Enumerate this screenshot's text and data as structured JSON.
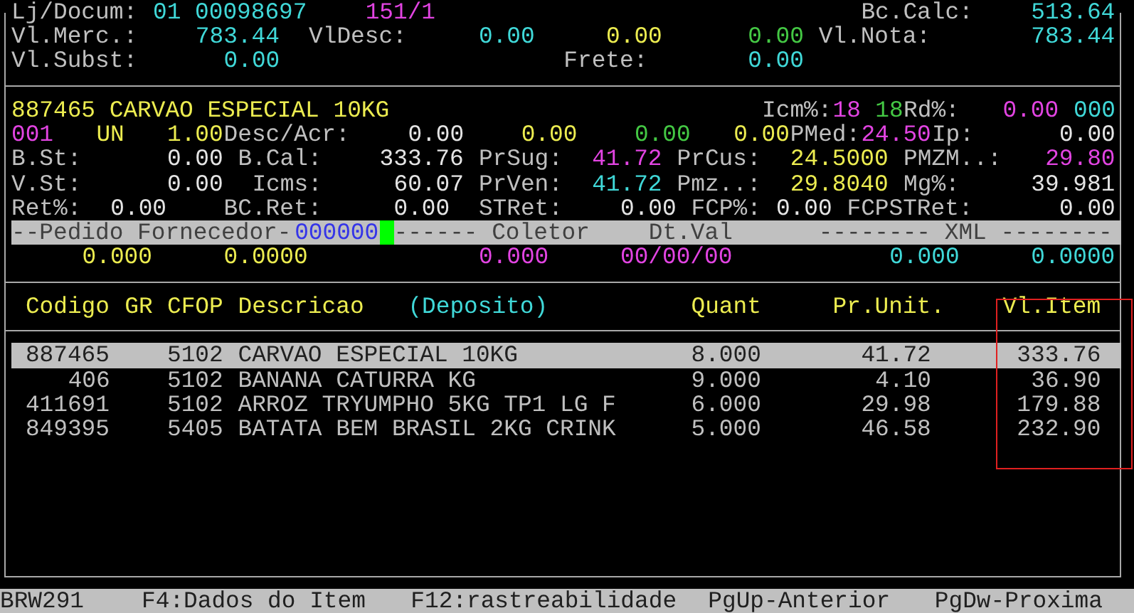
{
  "header_lines": [
    [
      "Lj/Docum:",
      "01 00098697",
      "151/1",
      "Bc.Calc:",
      "513.64"
    ],
    [
      "Vl.Merc.:",
      "783.44",
      "VlDesc:",
      "0.00",
      "0.00",
      "0.00",
      "Vl.Nota:",
      "783.44"
    ],
    [
      "Vl.Subst:",
      "0.00",
      "Frete:",
      "0.00"
    ]
  ],
  "item_lines": [
    [
      "887465 CARVAO ESPECIAL 10KG",
      "Icm%:",
      "18",
      "18",
      "Rd%:",
      "0.00",
      "000"
    ],
    [
      "001",
      "UN",
      "1.00",
      "Desc/Acr:",
      "0.00",
      "0.00",
      "0.00",
      "0.00",
      "PMed:",
      "24.50",
      "Ip:",
      "0.00"
    ],
    [
      "B.St:",
      "0.00",
      "B.Cal:",
      "333.76",
      "PrSug:",
      "41.72",
      "PrCus:",
      "24.5000",
      "PMZM..:",
      "29.80"
    ],
    [
      "V.St:",
      "0.00",
      "Icms:",
      "60.07",
      "PrVen:",
      "41.72",
      "Pmz..:",
      "29.8040",
      "Mg%:",
      "39.981"
    ],
    [
      "Ret%:",
      "0.00",
      "BC.Ret:",
      "0.00",
      "STRet:",
      "0.00",
      "FCP%:",
      "0.00",
      "FCPSTRet:",
      "0.00"
    ]
  ],
  "order_bar": [
    "--Pedido Fornecedor-",
    "000000",
    "------ Coletor",
    "Dt.Val",
    "-------- XML --------"
  ],
  "order_values": [
    "0.000",
    "0.0000",
    "0.000",
    "00/00/00",
    "0.000",
    "0.0000"
  ],
  "table": {
    "columns": [
      "Codigo",
      "GR",
      "CFOP",
      "Descricao",
      "(Deposito)",
      "Quant",
      "Pr.Unit.",
      "Vl.Item"
    ],
    "rows": [
      {
        "code": "887465",
        "cfop": "5102",
        "description": "CARVAO ESPECIAL 10KG",
        "quantity": "8.000",
        "unit_price": "41.72",
        "item_value": "333.76",
        "selected": true
      },
      {
        "code": "406",
        "cfop": "5102",
        "description": "BANANA CATURRA KG",
        "quantity": "9.000",
        "unit_price": "4.10",
        "item_value": "36.90",
        "selected": false
      },
      {
        "code": "411691",
        "cfop": "5102",
        "description": "ARROZ TRYUMPHO 5KG TP1 LG F",
        "quantity": "6.000",
        "unit_price": "29.98",
        "item_value": "179.88",
        "selected": false
      },
      {
        "code": "849395",
        "cfop": "5405",
        "description": "BATATA BEM BRASIL 2KG CRINK",
        "quantity": "5.000",
        "unit_price": "46.58",
        "item_value": "232.90",
        "selected": false
      }
    ]
  },
  "status_bar": [
    "BRW291",
    "F4:Dados do Item",
    "F12:rastreabilidade",
    "PgUp-Anterior",
    "PgDw-Proxima"
  ]
}
